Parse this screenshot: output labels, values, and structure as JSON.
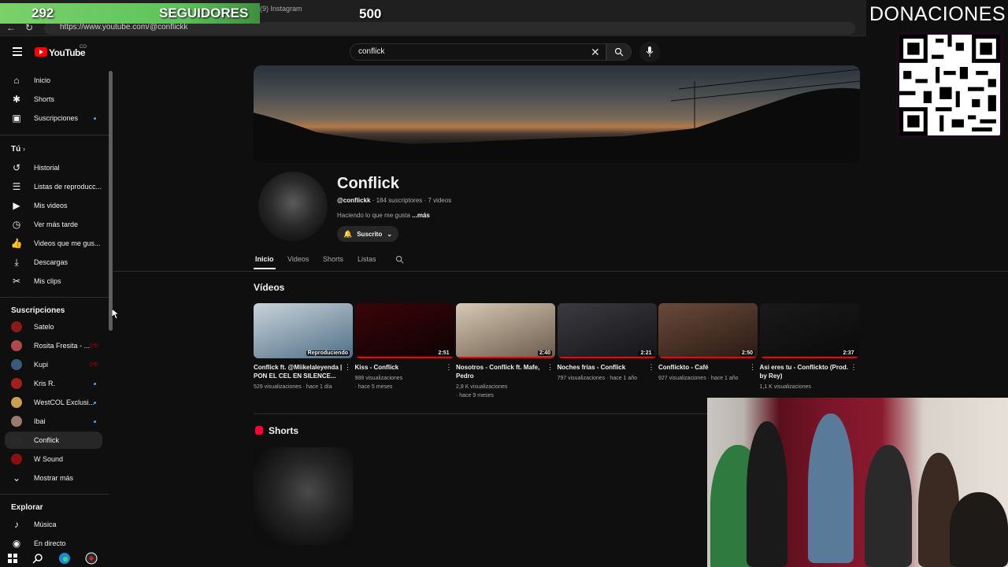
{
  "overlay": {
    "followers_count": "292",
    "followers_label": "SEGUIDORES",
    "followers_goal": "500",
    "donations_title": "DONACIONES"
  },
  "browser": {
    "tab_title": "(9) Instagram",
    "url": "https://www.youtube.com/@conflickk"
  },
  "header": {
    "logo_text": "YouTube",
    "logo_region": "CO",
    "search_value": "conflick"
  },
  "sidebar": {
    "main": [
      {
        "label": "Inicio",
        "icon": "home-icon"
      },
      {
        "label": "Shorts",
        "icon": "shorts-icon"
      },
      {
        "label": "Suscripciones",
        "icon": "subscriptions-icon"
      }
    ],
    "you_title": "Tú",
    "you_items": [
      {
        "label": "Historial",
        "icon": "history-icon"
      },
      {
        "label": "Listas de reproducc...",
        "icon": "playlists-icon"
      },
      {
        "label": "Mis videos",
        "icon": "my-videos-icon"
      },
      {
        "label": "Ver más tarde",
        "icon": "watch-later-icon"
      },
      {
        "label": "Videos que me gus...",
        "icon": "liked-icon"
      },
      {
        "label": "Descargas",
        "icon": "downloads-icon"
      },
      {
        "label": "Mis clips",
        "icon": "clips-icon"
      }
    ],
    "subs_title": "Suscripciones",
    "subs": [
      {
        "label": "Satelo",
        "avatar_color": "#8b1a1a"
      },
      {
        "label": "Rosita Fresita - ...",
        "avatar_color": "#b04a4a"
      },
      {
        "label": "Kupi",
        "avatar_color": "#3a5a7a"
      },
      {
        "label": "Kris R.",
        "avatar_color": "#a02020"
      },
      {
        "label": "WestCOL Exclusi...",
        "avatar_color": "#c8a050"
      },
      {
        "label": "Ibai",
        "avatar_color": "#9a7a6a"
      },
      {
        "label": "Conflick",
        "avatar_color": "#2a2a2a"
      },
      {
        "label": "W Sound",
        "avatar_color": "#8a1010"
      },
      {
        "label": "Mostrar más",
        "avatar_color": ""
      }
    ],
    "explore_title": "Explorar",
    "explore_items": [
      {
        "label": "Música",
        "icon": "music-icon"
      },
      {
        "label": "En directo",
        "icon": "live-icon"
      }
    ]
  },
  "channel": {
    "name": "Conflick",
    "handle": "@conflickk",
    "stats": " · 184 suscriptores · 7 videos",
    "description": "Haciendo lo que me gusta ",
    "more": "...más",
    "subscribe_label": "Suscrito",
    "tabs": [
      "Inicio",
      "Videos",
      "Shorts",
      "Listas"
    ]
  },
  "videos_section": {
    "title": "Vídeos",
    "items": [
      {
        "title": "Conflick ft. @Miikelaleyenda | PON EL CEL EN SILENCE...",
        "meta1": "529 visualizaciones · hace 1 día",
        "meta2": "",
        "duration": "Reproduciendo",
        "color1": "#c9d3da",
        "color2": "#4e6f86",
        "progress": 0
      },
      {
        "title": "Kiss - Conflick",
        "meta1": "988 visualizaciones",
        "meta2": "· hace 5 meses",
        "duration": "2:51",
        "color1": "#3a0508",
        "color2": "#0d0203",
        "progress": 1
      },
      {
        "title": "Nosotros - Conflick ft. Mafe, Pedro",
        "meta1": "2,8 K visualizaciones",
        "meta2": "· hace 9 meses",
        "duration": "2:40",
        "color1": "#d6c9b5",
        "color2": "#6b5a4a",
        "progress": 1
      },
      {
        "title": "Noches frías - Conflick",
        "meta1": "797 visualizaciones · hace 1 año",
        "meta2": "",
        "duration": "2:21",
        "color1": "#3a3a40",
        "color2": "#151518",
        "progress": 1
      },
      {
        "title": "Conflickto - Café",
        "meta1": "927 visualizaciones · hace 1 año",
        "meta2": "",
        "duration": "2:50",
        "color1": "#6a4a3a",
        "color2": "#2a1a14",
        "progress": 1
      },
      {
        "title": "Asi eres tu - Conflickto (Prod. by Rey)",
        "meta1": "1,1 K visualizaciones",
        "meta2": "",
        "duration": "2:37",
        "color1": "#1a1a1a",
        "color2": "#0a0a0a",
        "progress": 1
      }
    ]
  },
  "shorts_section": {
    "title": "Shorts"
  }
}
